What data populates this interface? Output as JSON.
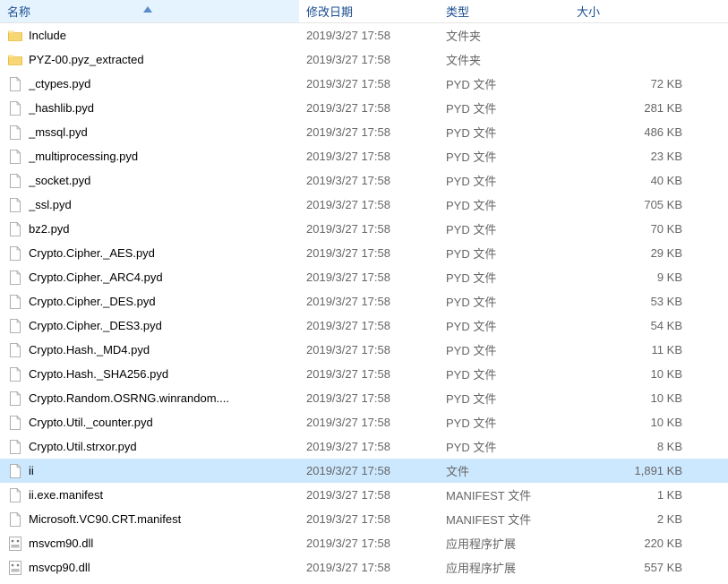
{
  "columns": {
    "name": "名称",
    "date": "修改日期",
    "type": "类型",
    "size": "大小"
  },
  "files": [
    {
      "icon": "folder",
      "name": "Include",
      "date": "2019/3/27 17:58",
      "type": "文件夹",
      "size": "",
      "selected": false
    },
    {
      "icon": "folder",
      "name": "PYZ-00.pyz_extracted",
      "date": "2019/3/27 17:58",
      "type": "文件夹",
      "size": "",
      "selected": false
    },
    {
      "icon": "file",
      "name": "_ctypes.pyd",
      "date": "2019/3/27 17:58",
      "type": "PYD 文件",
      "size": "72 KB",
      "selected": false
    },
    {
      "icon": "file",
      "name": "_hashlib.pyd",
      "date": "2019/3/27 17:58",
      "type": "PYD 文件",
      "size": "281 KB",
      "selected": false
    },
    {
      "icon": "file",
      "name": "_mssql.pyd",
      "date": "2019/3/27 17:58",
      "type": "PYD 文件",
      "size": "486 KB",
      "selected": false
    },
    {
      "icon": "file",
      "name": "_multiprocessing.pyd",
      "date": "2019/3/27 17:58",
      "type": "PYD 文件",
      "size": "23 KB",
      "selected": false
    },
    {
      "icon": "file",
      "name": "_socket.pyd",
      "date": "2019/3/27 17:58",
      "type": "PYD 文件",
      "size": "40 KB",
      "selected": false
    },
    {
      "icon": "file",
      "name": "_ssl.pyd",
      "date": "2019/3/27 17:58",
      "type": "PYD 文件",
      "size": "705 KB",
      "selected": false
    },
    {
      "icon": "file",
      "name": "bz2.pyd",
      "date": "2019/3/27 17:58",
      "type": "PYD 文件",
      "size": "70 KB",
      "selected": false
    },
    {
      "icon": "file",
      "name": "Crypto.Cipher._AES.pyd",
      "date": "2019/3/27 17:58",
      "type": "PYD 文件",
      "size": "29 KB",
      "selected": false
    },
    {
      "icon": "file",
      "name": "Crypto.Cipher._ARC4.pyd",
      "date": "2019/3/27 17:58",
      "type": "PYD 文件",
      "size": "9 KB",
      "selected": false
    },
    {
      "icon": "file",
      "name": "Crypto.Cipher._DES.pyd",
      "date": "2019/3/27 17:58",
      "type": "PYD 文件",
      "size": "53 KB",
      "selected": false
    },
    {
      "icon": "file",
      "name": "Crypto.Cipher._DES3.pyd",
      "date": "2019/3/27 17:58",
      "type": "PYD 文件",
      "size": "54 KB",
      "selected": false
    },
    {
      "icon": "file",
      "name": "Crypto.Hash._MD4.pyd",
      "date": "2019/3/27 17:58",
      "type": "PYD 文件",
      "size": "11 KB",
      "selected": false
    },
    {
      "icon": "file",
      "name": "Crypto.Hash._SHA256.pyd",
      "date": "2019/3/27 17:58",
      "type": "PYD 文件",
      "size": "10 KB",
      "selected": false
    },
    {
      "icon": "file",
      "name": "Crypto.Random.OSRNG.winrandom....",
      "date": "2019/3/27 17:58",
      "type": "PYD 文件",
      "size": "10 KB",
      "selected": false
    },
    {
      "icon": "file",
      "name": "Crypto.Util._counter.pyd",
      "date": "2019/3/27 17:58",
      "type": "PYD 文件",
      "size": "10 KB",
      "selected": false
    },
    {
      "icon": "file",
      "name": "Crypto.Util.strxor.pyd",
      "date": "2019/3/27 17:58",
      "type": "PYD 文件",
      "size": "8 KB",
      "selected": false
    },
    {
      "icon": "file",
      "name": "ii",
      "date": "2019/3/27 17:58",
      "type": "文件",
      "size": "1,891 KB",
      "selected": true
    },
    {
      "icon": "file",
      "name": "ii.exe.manifest",
      "date": "2019/3/27 17:58",
      "type": "MANIFEST 文件",
      "size": "1 KB",
      "selected": false
    },
    {
      "icon": "file",
      "name": "Microsoft.VC90.CRT.manifest",
      "date": "2019/3/27 17:58",
      "type": "MANIFEST 文件",
      "size": "2 KB",
      "selected": false
    },
    {
      "icon": "dll",
      "name": "msvcm90.dll",
      "date": "2019/3/27 17:58",
      "type": "应用程序扩展",
      "size": "220 KB",
      "selected": false
    },
    {
      "icon": "dll",
      "name": "msvcp90.dll",
      "date": "2019/3/27 17:58",
      "type": "应用程序扩展",
      "size": "557 KB",
      "selected": false
    }
  ]
}
